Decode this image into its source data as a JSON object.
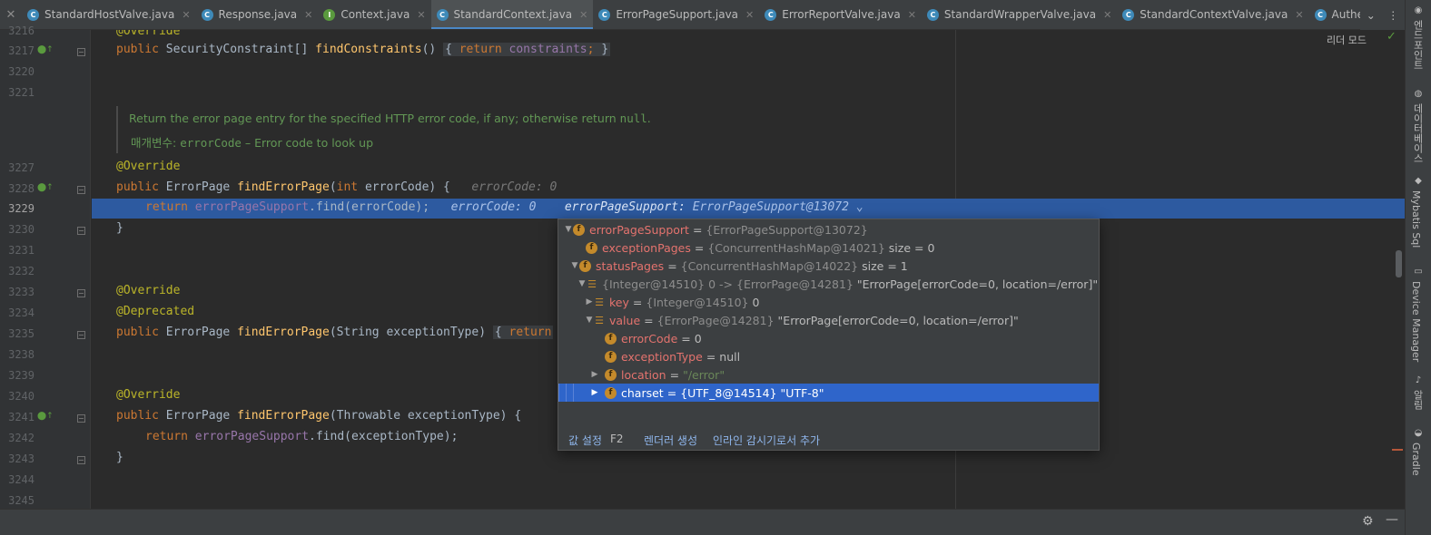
{
  "tabs": [
    {
      "label": "StandardHostValve.java",
      "icon": "C"
    },
    {
      "label": "Response.java",
      "icon": "C"
    },
    {
      "label": "Context.java",
      "icon": "I"
    },
    {
      "label": "StandardContext.java",
      "icon": "C",
      "active": true
    },
    {
      "label": "ErrorPageSupport.java",
      "icon": "C"
    },
    {
      "label": "ErrorReportValve.java",
      "icon": "C"
    },
    {
      "label": "StandardWrapperValve.java",
      "icon": "C"
    },
    {
      "label": "StandardContextValve.java",
      "icon": "C"
    },
    {
      "label": "AuthenticatorBase.java",
      "icon": "C"
    }
  ],
  "toolbar": {
    "reader_mode": "리더 모드"
  },
  "lines": [
    "3216",
    "3217",
    "3220",
    "3221",
    "3227",
    "3228",
    "3229",
    "3230",
    "3231",
    "3232",
    "3233",
    "3234",
    "3235",
    "3238",
    "3239",
    "3240",
    "3241",
    "3242",
    "3243",
    "3244",
    "3245"
  ],
  "code": {
    "l3216": "@Override",
    "l3217_kw": "public ",
    "l3217_type": "SecurityConstraint[] ",
    "l3217_fn": "findConstraints",
    "l3217_paren": "()",
    "l3217_ret": "return ",
    "l3217_fld": "constraints",
    "l3217_semi": ";",
    "l3217_close": "}",
    "l3217_open": "{",
    "doc_text": "Return the error page entry for the specified HTTP error code, if any; otherwise return ",
    "doc_null": "null",
    "doc_end": ".",
    "doc_param_label": "매개변수: ",
    "doc_param_name": "errorCode",
    "doc_param_desc": " – Error code to look up",
    "l3227": "@Override",
    "l3228_kw": "public ",
    "l3228_type": "ErrorPage ",
    "l3228_fn": "findErrorPage",
    "l3228_args_open": "(",
    "l3228_int": "int ",
    "l3228_param": "errorCode) {",
    "l3228_hint": "errorCode: 0",
    "l3229_ret": "return ",
    "l3229_fld": "errorPageSupport",
    "l3229_rest": ".find(errorCode);",
    "l3229_hint1": "errorCode: 0",
    "l3229_hint2_name": "errorPageSupport: ",
    "l3229_hint2_val": "ErrorPageSupport@13072",
    "l3230": "}",
    "l3233": "@Override",
    "l3234": "@Deprecated",
    "l3235_kw": "public ",
    "l3235_type": "ErrorPage ",
    "l3235_fn": "findErrorPage",
    "l3235_args": "(String exceptionType) ",
    "l3235_open": "{",
    "l3235_ret": "return",
    "l3240": "@Override",
    "l3241_kw": "public ",
    "l3241_type": "ErrorPage ",
    "l3241_fn": "findErrorPage",
    "l3241_args": "(Throwable exceptionType) {",
    "l3242_ret": "return ",
    "l3242_fld": "errorPageSupport",
    "l3242_rest": ".find(exceptionType);",
    "l3243": "}"
  },
  "debug": {
    "rows": [
      {
        "name": "errorPageSupport",
        "ref": "{ErrorPageSupport@13072}",
        "val": ""
      },
      {
        "name": "exceptionPages",
        "ref": "{ConcurrentHashMap@14021}",
        "val": "size = 0"
      },
      {
        "name": "statusPages",
        "ref": "{ConcurrentHashMap@14022}",
        "val": "size = 1"
      },
      {
        "name": "",
        "ref": "{Integer@14510} 0 -> {ErrorPage@14281}",
        "val": "\"ErrorPage[errorCode=0, location=/error]\""
      },
      {
        "name": "key",
        "ref": "{Integer@14510}",
        "val": "0"
      },
      {
        "name": "value",
        "ref": "{ErrorPage@14281}",
        "val": "\"ErrorPage[errorCode=0, location=/error]\""
      },
      {
        "name": "errorCode",
        "ref": "",
        "val": "0"
      },
      {
        "name": "exceptionType",
        "ref": "",
        "val": "null"
      },
      {
        "name": "location",
        "ref": "",
        "val": "\"/error\""
      },
      {
        "name": "charset",
        "ref": "{UTF_8@14514}",
        "val": "\"UTF-8\""
      }
    ],
    "footer": {
      "set_value": "값 설정",
      "set_value_key": "F2",
      "create_renderer": "렌더러 생성",
      "add_inline_watch": "인라인 감시기로서 추가"
    }
  },
  "rightbar": {
    "bookmarks": "엔드포인트",
    "database": "데이터베이스",
    "mybatis": "Mybatis Sql",
    "device_manager": "Device Manager",
    "notifications": "알림",
    "gradle": "Gradle"
  }
}
